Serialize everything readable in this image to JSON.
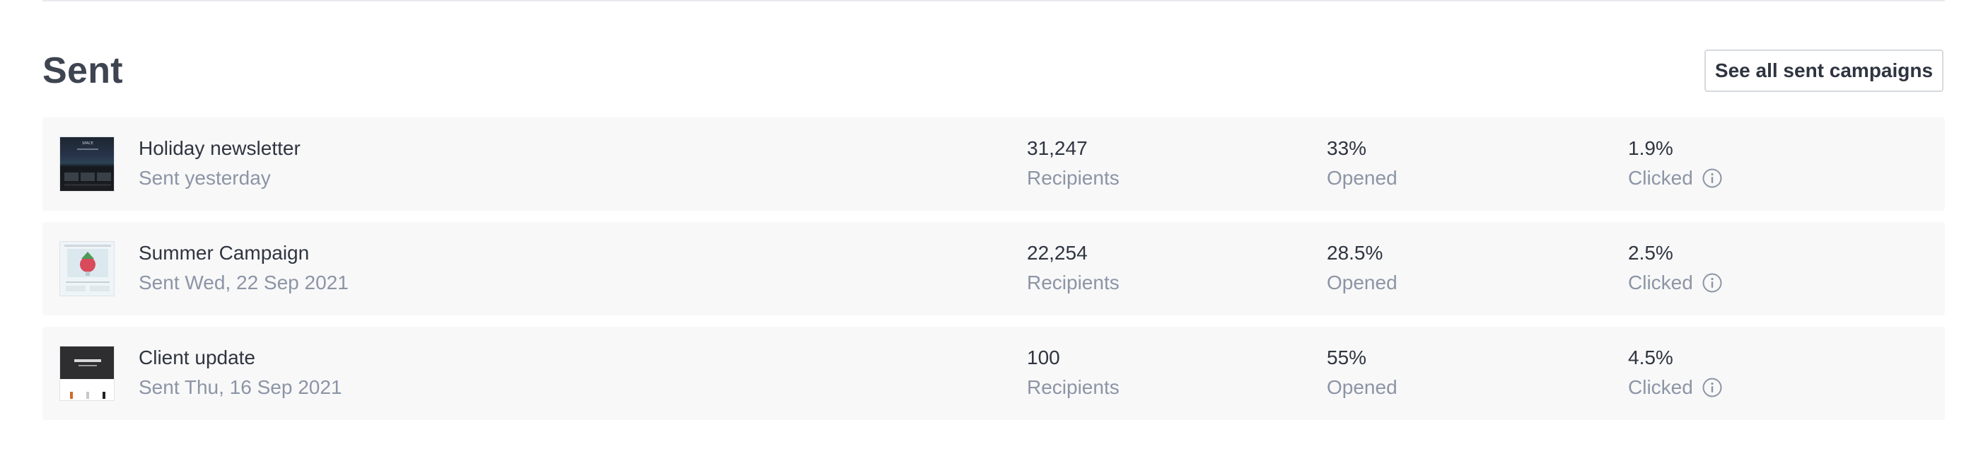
{
  "section": {
    "title": "Sent",
    "see_all_label": "See all sent campaigns"
  },
  "campaigns": [
    {
      "name": "Holiday newsletter",
      "sent": "Sent yesterday",
      "recipients": "31,247",
      "recipients_label": "Recipients",
      "opened": "33%",
      "opened_label": "Opened",
      "clicked": "1.9%",
      "clicked_label": "Clicked",
      "thumbnail": "space-newsletter-thumbnail"
    },
    {
      "name": "Summer Campaign",
      "sent": "Sent Wed, 22 Sep 2021",
      "recipients": "22,254",
      "recipients_label": "Recipients",
      "opened": "28.5%",
      "opened_label": "Opened",
      "clicked": "2.5%",
      "clicked_label": "Clicked",
      "thumbnail": "summer-drink-thumbnail"
    },
    {
      "name": "Client update",
      "sent": "Sent Thu, 16 Sep 2021",
      "recipients": "100",
      "recipients_label": "Recipients",
      "opened": "55%",
      "opened_label": "Opened",
      "clicked": "4.5%",
      "clicked_label": "Clicked",
      "thumbnail": "client-update-thumbnail"
    }
  ],
  "icons": {
    "info": "info-icon"
  },
  "colors": {
    "title": "#3e4450",
    "primary_text": "#2f3540",
    "secondary_text": "#8c95a5",
    "row_background": "#f8f8f9",
    "button_border": "#d6d9de"
  }
}
